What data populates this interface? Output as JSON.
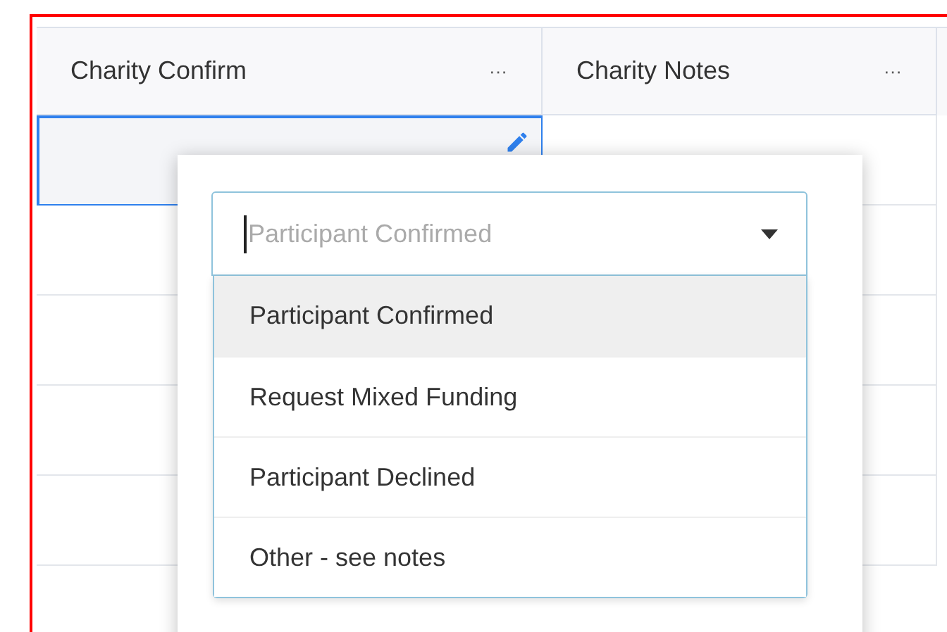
{
  "columns": [
    {
      "title": "Charity Confirm",
      "menu": "···"
    },
    {
      "title": "Charity Notes",
      "menu": "···"
    }
  ],
  "editor": {
    "placeholder": "Participant Confirmed",
    "options": [
      {
        "label": "Participant Confirmed",
        "selected": true
      },
      {
        "label": "Request Mixed Funding",
        "selected": false
      },
      {
        "label": "Participant Declined",
        "selected": false
      },
      {
        "label": "Other - see notes",
        "selected": false
      }
    ]
  }
}
